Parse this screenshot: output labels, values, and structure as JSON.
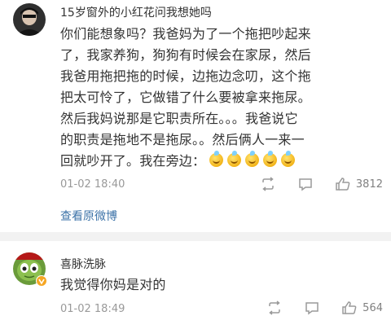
{
  "comments": [
    {
      "username": "15岁窗外的小红花问我想她吗",
      "text_lines": [
        "你们能想象吗？我爸妈为了一个拖把吵起来",
        "了，我家养狗，狗狗有时候会在家尿，然后",
        "我爸用拖把拖的时候，边拖边念叨，这个拖",
        "把太可怜了，它做错了什么要被拿来拖尿。",
        "然后我妈说那是它职责所在。。。我爸说它",
        "的职责是拖地不是拖尿。。然后俩人一来一",
        "回就吵开了。我在旁边："
      ],
      "emoji_icon": "laughing-emoji",
      "date": "01-02 18:40",
      "like_count": "3812",
      "view_link": "查看原微博"
    },
    {
      "username": "喜脉洗脉",
      "text_lines": [
        "我觉得你妈是对的"
      ],
      "date": "01-02 18:49",
      "like_count": "564"
    }
  ],
  "colors": {
    "link": "#3d73a8",
    "meta": "#999999",
    "divider": "#f2f2f2",
    "verified_badge": "#f5a623"
  },
  "icons": {
    "repost": "repost-icon",
    "comment": "comment-icon",
    "like": "thumbs-up-icon"
  }
}
